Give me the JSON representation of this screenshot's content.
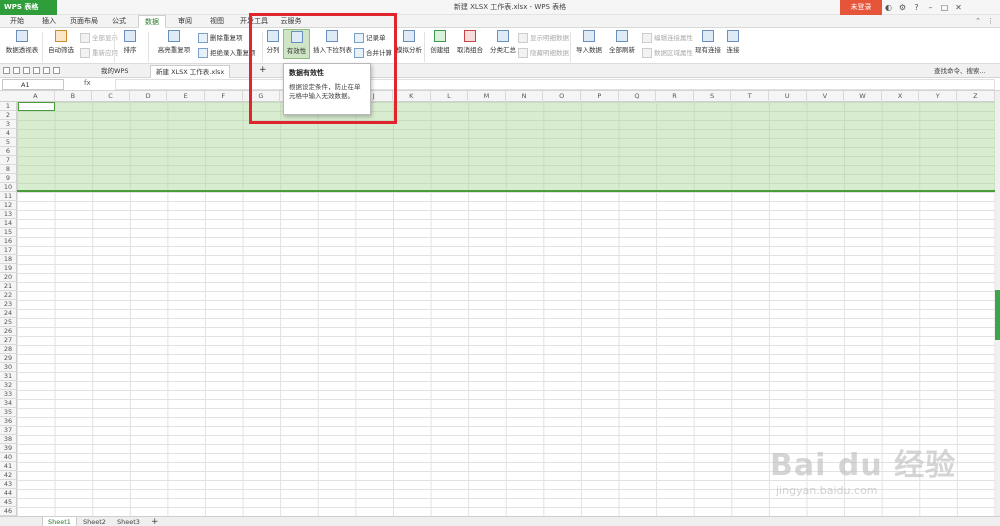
{
  "app": {
    "brand": "WPS 表格",
    "doc_title": "新建 XLSX 工作表.xlsx - WPS 表格",
    "login": "未登录"
  },
  "menu": {
    "tabs": [
      "开始",
      "插入",
      "页面布局",
      "公式",
      "数据",
      "审阅",
      "视图",
      "开发工具",
      "云服务"
    ],
    "active": "数据"
  },
  "ribbon": {
    "pivot": "数据透视表",
    "autofilter": "自动筛选",
    "show_all": "全部显示",
    "reapply": "重新应用",
    "sort": "排序",
    "highlight_dup": "高亮重复项",
    "delete_dup": "删除重复项",
    "reject_dup": "拒绝录入重复项",
    "split": "分列",
    "validity": "有效性",
    "insert_dropdown": "插入下拉列表",
    "record": "记录单",
    "consolidate": "合并计算",
    "whatif": "模拟分析",
    "create_group": "创建组",
    "ungroup": "取消组合",
    "subtotal": "分类汇总",
    "show_detail": "显示明细数据",
    "hide_detail": "隐藏明细数据",
    "import_data": "导入数据",
    "refresh_all": "全部刷新",
    "edit_link": "编辑连接属性",
    "data_area": "数据区域属性",
    "existing_conn": "现有连接",
    "connect": "连接"
  },
  "doc_tabs": {
    "home": "我的WPS",
    "file": "新建 XLSX 工作表.xlsx",
    "search": "查找命令、搜索..."
  },
  "formula_bar": {
    "cell_ref": "A1",
    "fx": "fx"
  },
  "grid": {
    "columns": [
      "A",
      "B",
      "C",
      "D",
      "E",
      "F",
      "G",
      "H",
      "I",
      "J",
      "K",
      "L",
      "M",
      "N",
      "O",
      "P",
      "Q",
      "R",
      "S",
      "T",
      "U",
      "V",
      "W",
      "X",
      "Y",
      "Z"
    ],
    "rows": [
      "1",
      "2",
      "3",
      "4",
      "5",
      "6",
      "7",
      "8",
      "9",
      "10",
      "11",
      "12",
      "13",
      "14",
      "15",
      "16",
      "17",
      "18",
      "19",
      "20",
      "21",
      "22",
      "23",
      "24",
      "25",
      "26",
      "27",
      "28",
      "29",
      "30",
      "31",
      "32",
      "33",
      "34",
      "35",
      "36",
      "37",
      "38",
      "39",
      "40",
      "41",
      "42",
      "43",
      "44",
      "45",
      "46"
    ]
  },
  "tooltip": {
    "title": "数据有效性",
    "body": "根据设定条件，防止在单元格中输入无效数据。"
  },
  "sheets": [
    "Sheet1",
    "Sheet2",
    "Sheet3"
  ],
  "watermark": {
    "main": "Bai du 经验",
    "url": "jingyan.baidu.com"
  },
  "colors": {
    "accent": "#2f9e3a",
    "selection": "#a8d696",
    "highlight_box": "#e0262d"
  }
}
